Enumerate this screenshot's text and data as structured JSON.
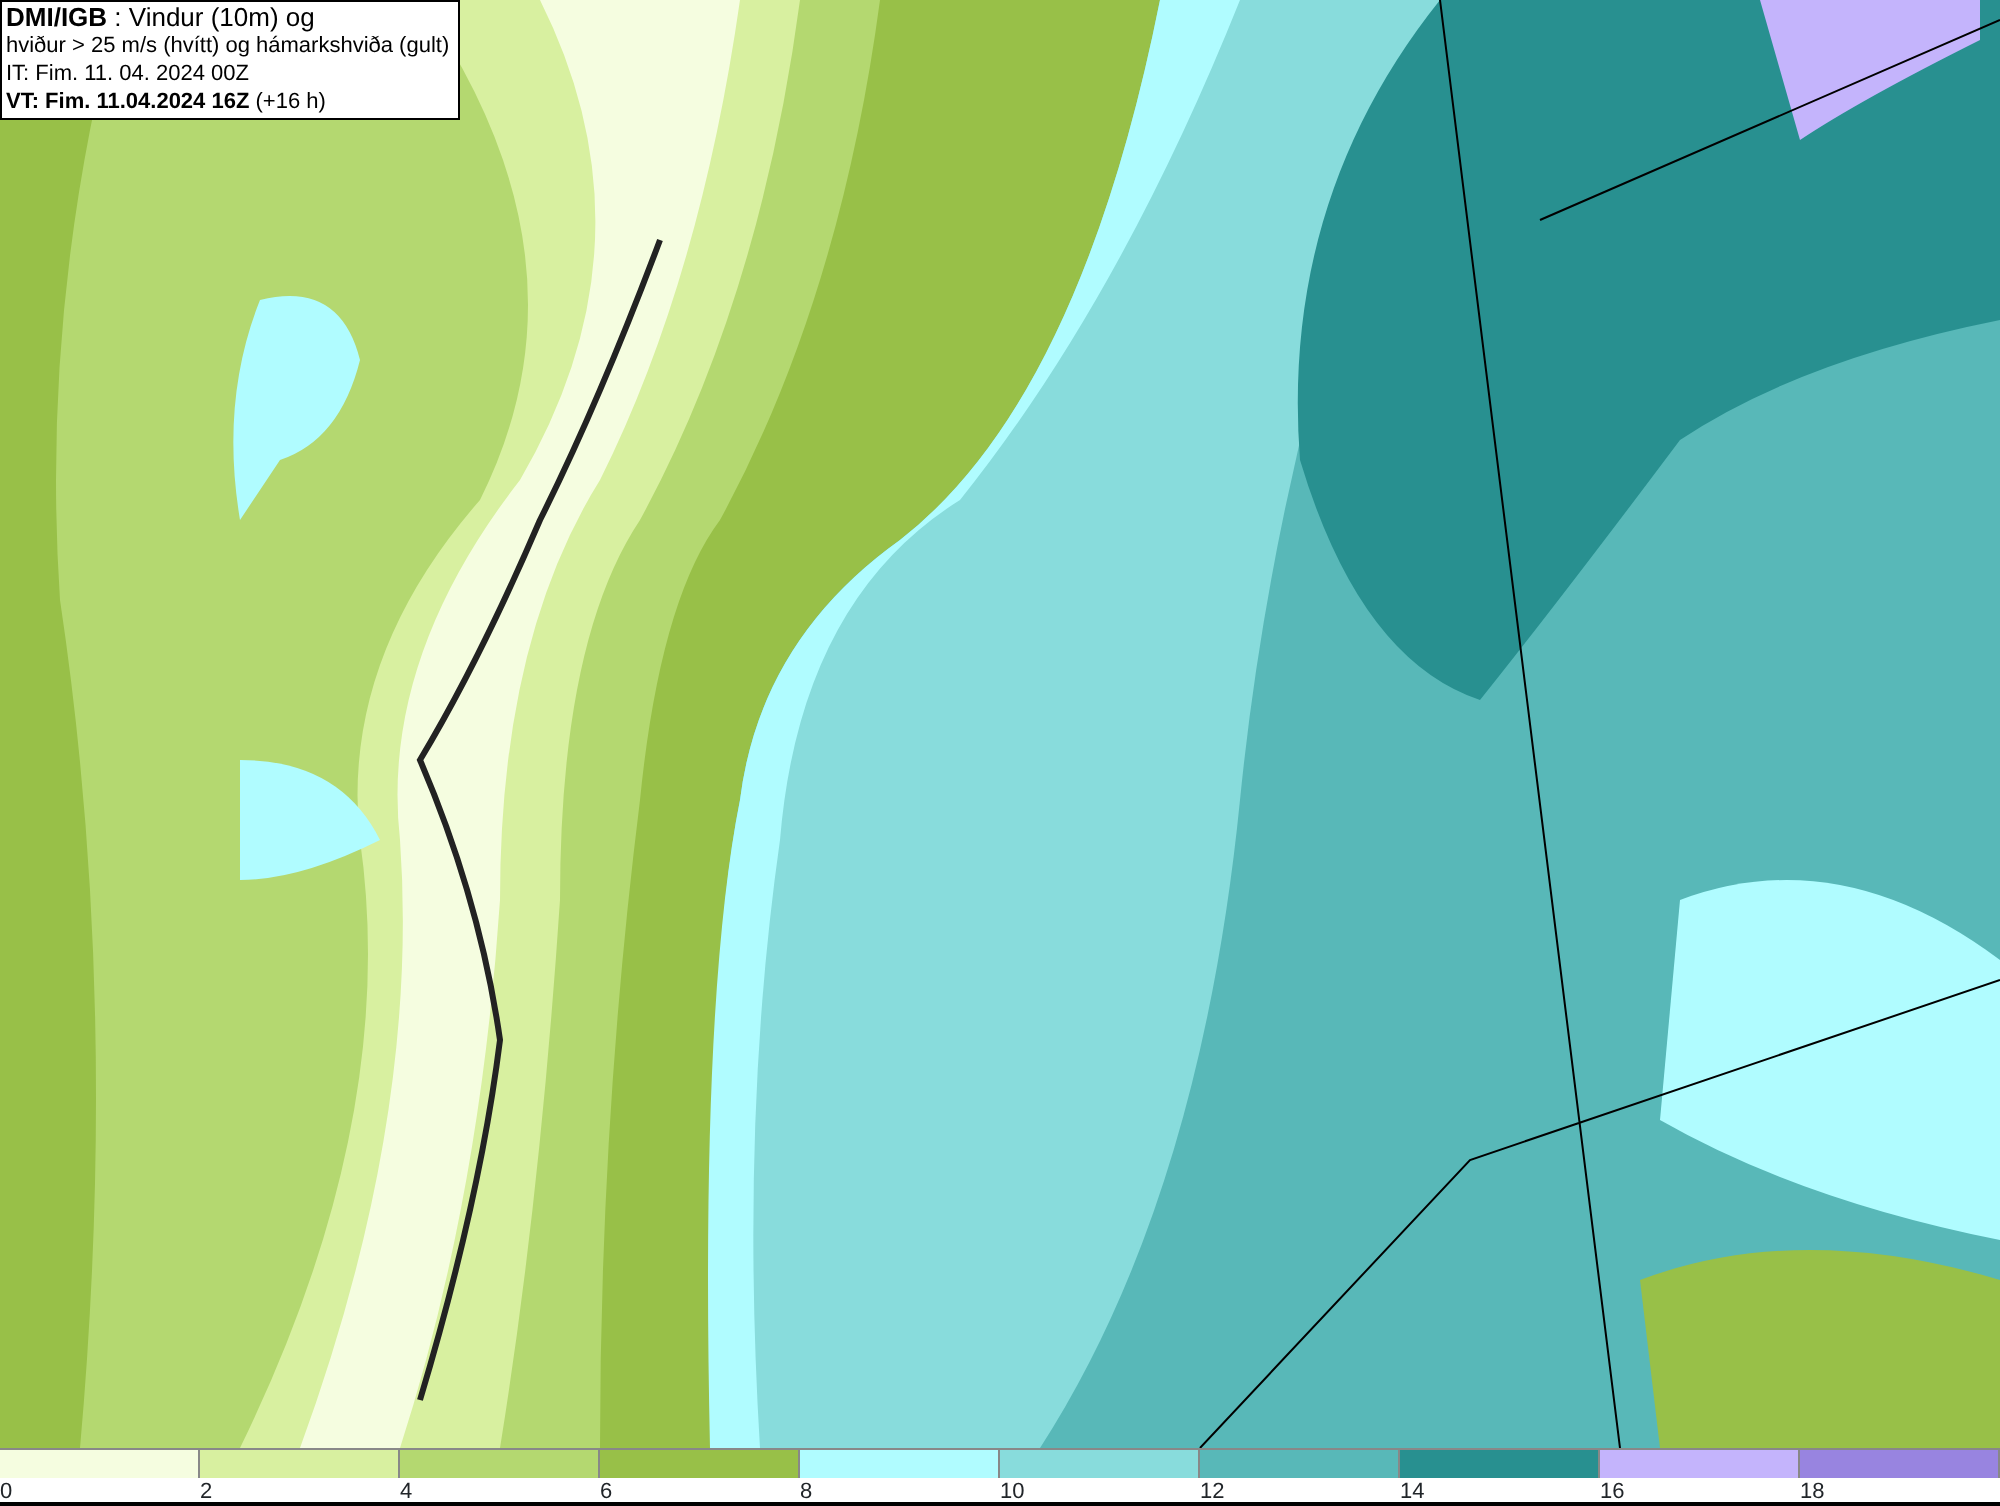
{
  "info_box": {
    "lines": [
      "**DMI/IGB** : Vindur (10m) og",
      "hviður > 25 m/s (hvítt) og hámarkshviða (gult)",
      "IT: Fim. 11. 04. 2024 00Z",
      "**VT: Fim. 11.04.2024 16Z** (+16 h)"
    ]
  },
  "legend": [
    {
      "label": "0",
      "color": "#f5fde0"
    },
    {
      "label": "2",
      "color": "#d8f0a0"
    },
    {
      "label": "4",
      "color": "#b4d870"
    },
    {
      "label": "6",
      "color": "#98c048"
    },
    {
      "label": "8",
      "color": "#b0fcff"
    },
    {
      "label": "10",
      "color": "#88dcdc"
    },
    {
      "label": "12",
      "color": "#58b8b8"
    },
    {
      "label": "14",
      "color": "#289090"
    },
    {
      "label": "16",
      "color": "#c4b4fc"
    },
    {
      "label": "18",
      "color": "#9884e0"
    }
  ]
}
